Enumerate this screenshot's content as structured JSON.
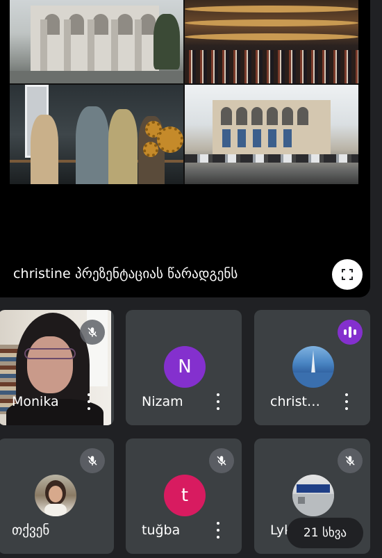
{
  "presentation": {
    "caption": "christine პრეზენტაციას წარადგენს",
    "fullscreen_icon": "fullscreen-icon"
  },
  "participants": [
    {
      "name": "Monika",
      "status": "muted",
      "has_video": true
    },
    {
      "name": "Nizam",
      "initial": "N",
      "avatar_color": "#8430ce",
      "status": "none"
    },
    {
      "name": "christ…",
      "status": "speaking",
      "avatar": "photo"
    },
    {
      "name": "თქვენ",
      "status": "muted",
      "avatar": "photo"
    },
    {
      "name": "tuğba",
      "initial": "t",
      "avatar_color": "#d81b60",
      "status": "muted"
    },
    {
      "name": "LykP",
      "status": "muted",
      "avatar": "photo"
    }
  ],
  "overflow": {
    "label": "21 სხვა"
  },
  "colors": {
    "background": "#202124",
    "tile": "#3c4043",
    "speaking": "#8430ce",
    "presentation_bg": "#000000"
  }
}
